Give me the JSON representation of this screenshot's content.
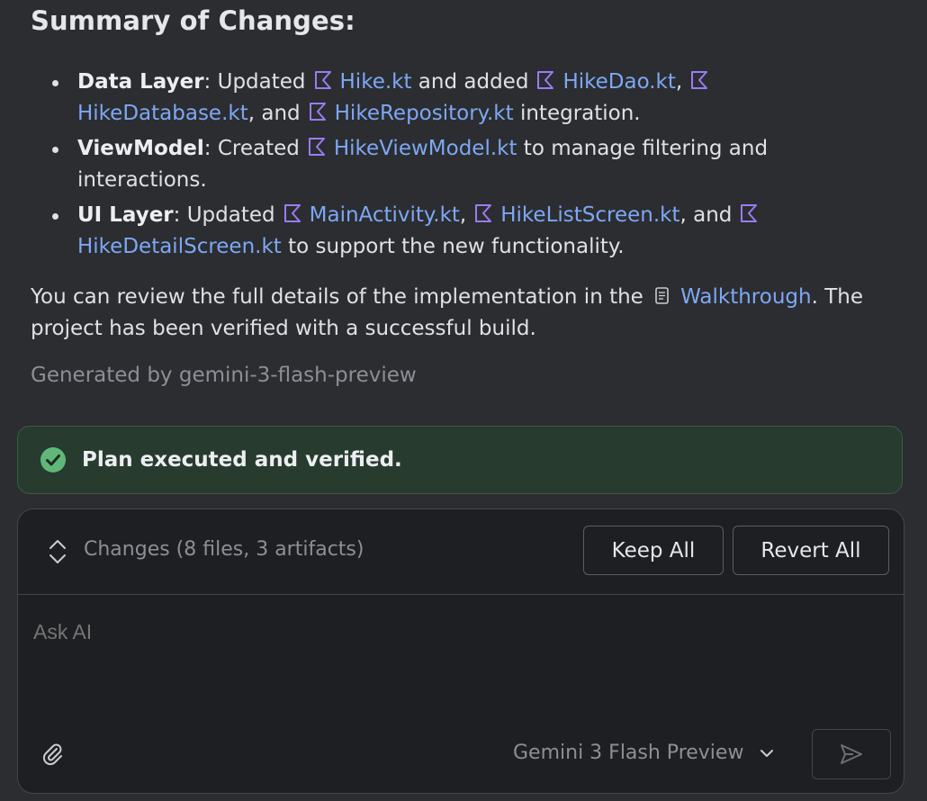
{
  "summary": {
    "title": "Summary of Changes:",
    "items": [
      {
        "term": "Data Layer",
        "parts": [
          {
            "t": "text",
            "v": ": Updated"
          },
          {
            "t": "file",
            "v": "Hike.kt"
          },
          {
            "t": "text",
            "v": " and added"
          },
          {
            "t": "file",
            "v": "HikeDao.kt"
          },
          {
            "t": "text",
            "v": ","
          },
          {
            "t": "file",
            "v": "HikeDatabase.kt"
          },
          {
            "t": "text",
            "v": ", and"
          },
          {
            "t": "file",
            "v": "HikeRepository.kt"
          },
          {
            "t": "text",
            "v": " integration."
          }
        ]
      },
      {
        "term": "ViewModel",
        "parts": [
          {
            "t": "text",
            "v": ": Created"
          },
          {
            "t": "file",
            "v": "HikeViewModel.kt"
          },
          {
            "t": "text",
            "v": " to manage filtering and interactions."
          }
        ]
      },
      {
        "term": "UI Layer",
        "parts": [
          {
            "t": "text",
            "v": ": Updated"
          },
          {
            "t": "file",
            "v": "MainActivity.kt"
          },
          {
            "t": "text",
            "v": ","
          },
          {
            "t": "file",
            "v": "HikeListScreen.kt"
          },
          {
            "t": "text",
            "v": ", and"
          },
          {
            "t": "file",
            "v": "HikeDetailScreen.kt"
          },
          {
            "t": "text",
            "v": " to support the new functionality."
          }
        ]
      }
    ],
    "paragraph_before": "You can review the full details of the implementation in the",
    "walkthrough_link": "Walkthrough",
    "paragraph_after": ". The project has been verified with a successful build.",
    "generated_by": "Generated by gemini-3-flash-preview"
  },
  "status": {
    "text": "Plan executed and verified.",
    "icon": "check-circle-icon",
    "color": "#5fb87a"
  },
  "changes": {
    "label": "Changes (8 files, 3 artifacts)",
    "keep_all": "Keep All",
    "revert_all": "Revert All"
  },
  "input": {
    "placeholder": "Ask AI",
    "value": ""
  },
  "model": {
    "selected": "Gemini 3 Flash Preview"
  },
  "colors": {
    "link": "#7ea7f5",
    "kotlin_icon": "#9b7cf2",
    "banner_bg": "#273b2f",
    "panel_bg": "#1e1f22",
    "page_bg": "#2b2d30"
  }
}
